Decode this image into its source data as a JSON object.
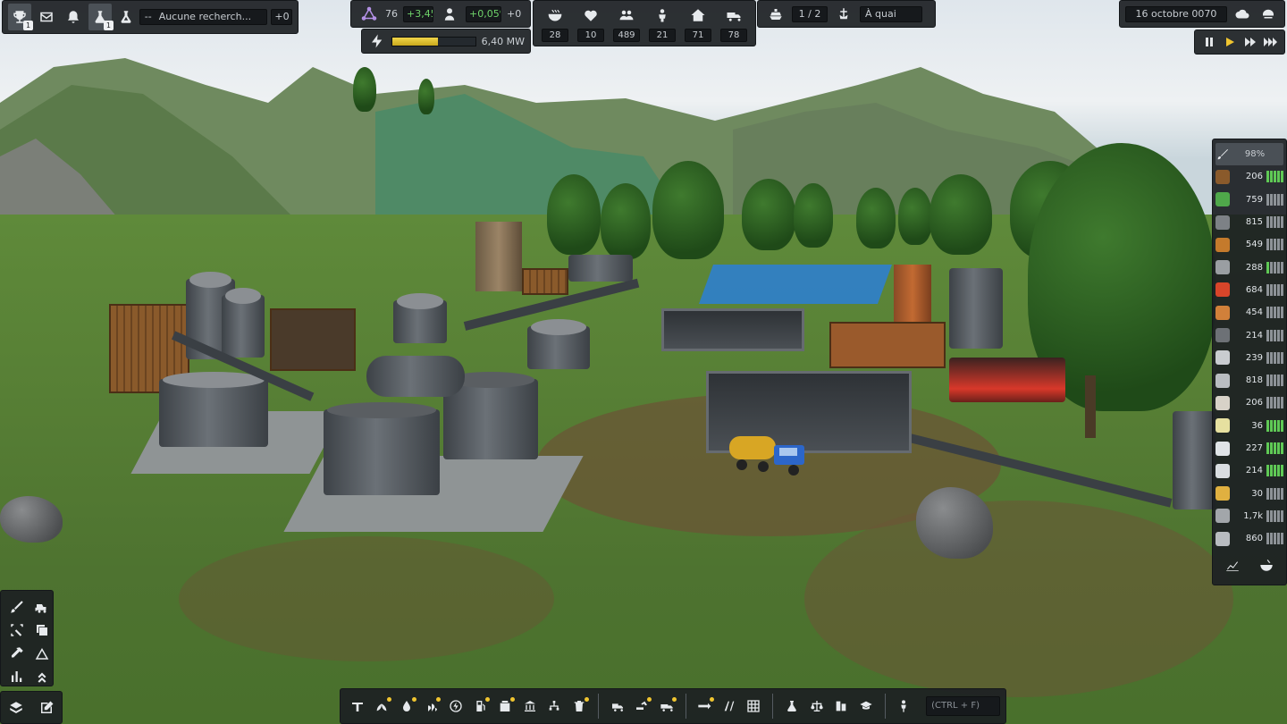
{
  "top_left": {
    "trophy_badge": "1",
    "research_badge": "1",
    "research_value": "--",
    "research_label": "Aucune recherch...",
    "research_delta": "+0",
    "icons": [
      "trophy-icon",
      "mail-icon",
      "bell-icon",
      "flask-icon",
      "flask-icon"
    ]
  },
  "stats": {
    "unity_value": "76",
    "unity_delta": "+3,45",
    "population_change": "+0,05%",
    "population_delta": "+0"
  },
  "power": {
    "label": "6,40 MW",
    "fill_fraction": 0.55
  },
  "needs": [
    {
      "icon": "food-icon",
      "value": "28"
    },
    {
      "icon": "health-icon",
      "value": "10"
    },
    {
      "icon": "people-icon",
      "value": "489"
    },
    {
      "icon": "worker-icon",
      "value": "21"
    },
    {
      "icon": "house-icon",
      "value": "71"
    },
    {
      "icon": "truck-icon",
      "value": "78"
    }
  ],
  "ships": {
    "count": "1 / 2",
    "status": "À quai"
  },
  "date": {
    "label": "16 octobre 0070"
  },
  "speed": {
    "active": "play"
  },
  "resources": {
    "header_value": "98%",
    "items": [
      {
        "icon": "wood-icon",
        "value": "206",
        "color": "#8a5a2b",
        "green": 5
      },
      {
        "icon": "food-crate-icon",
        "value": "759",
        "color": "#4fa84a",
        "green": 0
      },
      {
        "icon": "iron-ore-icon",
        "value": "815",
        "color": "#7d8186",
        "green": 0
      },
      {
        "icon": "barrel-icon",
        "value": "549",
        "color": "#c47a2c",
        "green": 0
      },
      {
        "icon": "plank-icon",
        "value": "288",
        "color": "#9a9ea2",
        "green": 1
      },
      {
        "icon": "fuel-icon",
        "value": "684",
        "color": "#d8452a",
        "green": 0
      },
      {
        "icon": "copper-icon",
        "value": "454",
        "color": "#d1803a",
        "green": 0
      },
      {
        "icon": "steel-icon",
        "value": "214",
        "color": "#6d7176",
        "green": 0
      },
      {
        "icon": "tool-icon",
        "value": "239",
        "color": "#c9ccd0",
        "green": 0
      },
      {
        "icon": "cement-icon",
        "value": "818",
        "color": "#b9bdc1",
        "green": 0
      },
      {
        "icon": "brick-icon",
        "value": "206",
        "color": "#d8d2c8",
        "green": 0
      },
      {
        "icon": "fertilizer-icon",
        "value": "36",
        "color": "#e6e0a0",
        "green": 5
      },
      {
        "icon": "water-icon",
        "value": "227",
        "color": "#dfe3e7",
        "green": 5
      },
      {
        "icon": "electronics-icon",
        "value": "214",
        "color": "#d9dde1",
        "green": 5
      },
      {
        "icon": "gold-icon",
        "value": "30",
        "color": "#e0b040",
        "green": 0
      },
      {
        "icon": "stone-icon",
        "value": "1,7k",
        "color": "#a2a6aa",
        "green": 0
      },
      {
        "icon": "gravel-icon",
        "value": "860",
        "color": "#b8bcc0",
        "green": 0
      }
    ]
  },
  "bottom": {
    "search_placeholder": "(CTRL + F)"
  }
}
